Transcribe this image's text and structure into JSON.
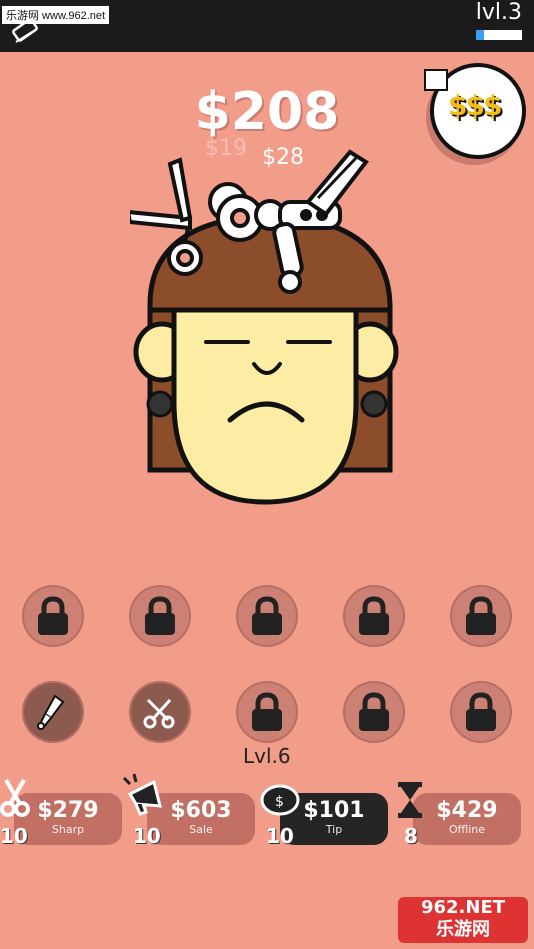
{
  "topbar": {
    "watermark": "乐游网 www.962.net",
    "level_label": "lvl.3",
    "level_progress": 0.17
  },
  "money": {
    "total": "$208",
    "floating_1": "$19",
    "floating_2": "$28"
  },
  "reward_button": {
    "glyph": "$$$"
  },
  "slots": [
    {
      "icon": "lock-icon",
      "locked": true
    },
    {
      "icon": "lock-icon",
      "locked": true
    },
    {
      "icon": "lock-icon",
      "locked": true
    },
    {
      "icon": "lock-icon",
      "locked": true
    },
    {
      "icon": "lock-icon",
      "locked": true
    },
    {
      "icon": "razor-icon",
      "locked": false
    },
    {
      "icon": "scissors-icon",
      "locked": false
    },
    {
      "icon": "lock-icon",
      "locked": true
    },
    {
      "icon": "lock-icon",
      "locked": true
    },
    {
      "icon": "lock-icon",
      "locked": true
    }
  ],
  "next_unlock_label": "Lvl.6",
  "upgrades": [
    {
      "name": "sharp",
      "price": "$279",
      "label": "Sharp",
      "count": "10",
      "icon": "scissors-icon"
    },
    {
      "name": "sale",
      "price": "$603",
      "label": "Sale",
      "count": "10",
      "icon": "megaphone-icon"
    },
    {
      "name": "tip",
      "price": "$101",
      "label": "Tip",
      "count": "10",
      "icon": "piggy-bank-icon"
    },
    {
      "name": "offline",
      "price": "$429",
      "label": "Offline",
      "count": "8",
      "icon": "hourglass-icon"
    }
  ],
  "watermark_bottom": {
    "line1": "962.NET",
    "line2": "乐游网"
  },
  "colors": {
    "background": "#f29c8a",
    "hair": "#8b4d2a",
    "skin": "#fdeca4",
    "topbar": "#1b1b1b",
    "accent_gold": "#f3bd17"
  }
}
